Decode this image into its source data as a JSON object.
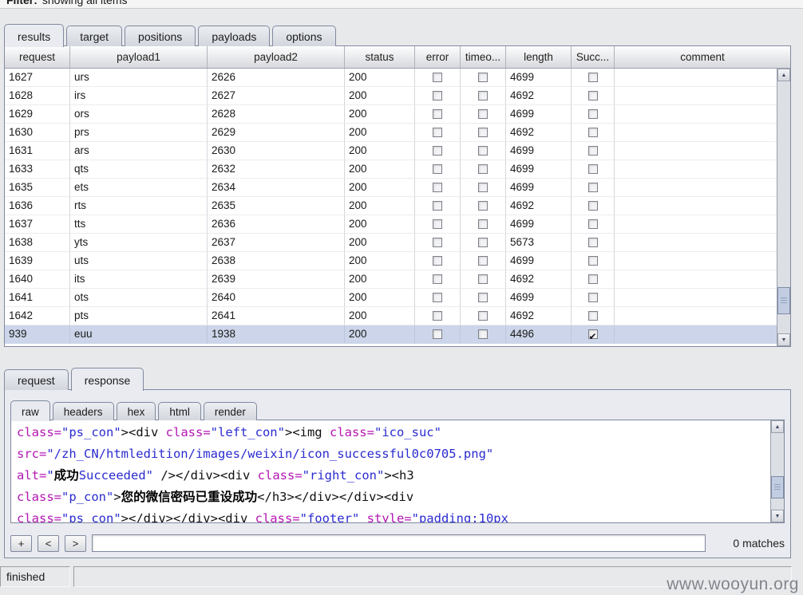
{
  "filter": {
    "label": "Filter:",
    "text": "showing all items"
  },
  "main_tabs": [
    "results",
    "target",
    "positions",
    "payloads",
    "options"
  ],
  "table": {
    "columns": [
      {
        "key": "request",
        "label": "request",
        "type": "text"
      },
      {
        "key": "payload1",
        "label": "payload1",
        "type": "text"
      },
      {
        "key": "payload2",
        "label": "payload2",
        "type": "text"
      },
      {
        "key": "status",
        "label": "status",
        "type": "text"
      },
      {
        "key": "error",
        "label": "error",
        "type": "check"
      },
      {
        "key": "timeout",
        "label": "timeo...",
        "type": "check"
      },
      {
        "key": "length",
        "label": "length",
        "type": "text"
      },
      {
        "key": "success",
        "label": "Succ...",
        "type": "check"
      },
      {
        "key": "comment",
        "label": "comment",
        "type": "text"
      }
    ],
    "selected_index": 14,
    "rows": [
      {
        "request": "1627",
        "payload1": "urs",
        "payload2": "2626",
        "status": "200",
        "error": false,
        "timeout": false,
        "length": "4699",
        "success": false,
        "comment": ""
      },
      {
        "request": "1628",
        "payload1": "irs",
        "payload2": "2627",
        "status": "200",
        "error": false,
        "timeout": false,
        "length": "4692",
        "success": false,
        "comment": ""
      },
      {
        "request": "1629",
        "payload1": "ors",
        "payload2": "2628",
        "status": "200",
        "error": false,
        "timeout": false,
        "length": "4699",
        "success": false,
        "comment": ""
      },
      {
        "request": "1630",
        "payload1": "prs",
        "payload2": "2629",
        "status": "200",
        "error": false,
        "timeout": false,
        "length": "4692",
        "success": false,
        "comment": ""
      },
      {
        "request": "1631",
        "payload1": "ars",
        "payload2": "2630",
        "status": "200",
        "error": false,
        "timeout": false,
        "length": "4699",
        "success": false,
        "comment": ""
      },
      {
        "request": "1633",
        "payload1": "qts",
        "payload2": "2632",
        "status": "200",
        "error": false,
        "timeout": false,
        "length": "4699",
        "success": false,
        "comment": ""
      },
      {
        "request": "1635",
        "payload1": "ets",
        "payload2": "2634",
        "status": "200",
        "error": false,
        "timeout": false,
        "length": "4699",
        "success": false,
        "comment": ""
      },
      {
        "request": "1636",
        "payload1": "rts",
        "payload2": "2635",
        "status": "200",
        "error": false,
        "timeout": false,
        "length": "4692",
        "success": false,
        "comment": ""
      },
      {
        "request": "1637",
        "payload1": "tts",
        "payload2": "2636",
        "status": "200",
        "error": false,
        "timeout": false,
        "length": "4699",
        "success": false,
        "comment": ""
      },
      {
        "request": "1638",
        "payload1": "yts",
        "payload2": "2637",
        "status": "200",
        "error": false,
        "timeout": false,
        "length": "5673",
        "success": false,
        "comment": ""
      },
      {
        "request": "1639",
        "payload1": "uts",
        "payload2": "2638",
        "status": "200",
        "error": false,
        "timeout": false,
        "length": "4699",
        "success": false,
        "comment": ""
      },
      {
        "request": "1640",
        "payload1": "its",
        "payload2": "2639",
        "status": "200",
        "error": false,
        "timeout": false,
        "length": "4692",
        "success": false,
        "comment": ""
      },
      {
        "request": "1641",
        "payload1": "ots",
        "payload2": "2640",
        "status": "200",
        "error": false,
        "timeout": false,
        "length": "4699",
        "success": false,
        "comment": ""
      },
      {
        "request": "1642",
        "payload1": "pts",
        "payload2": "2641",
        "status": "200",
        "error": false,
        "timeout": false,
        "length": "4692",
        "success": false,
        "comment": ""
      },
      {
        "request": "939",
        "payload1": "euu",
        "payload2": "1938",
        "status": "200",
        "error": false,
        "timeout": false,
        "length": "4496",
        "success": true,
        "comment": ""
      }
    ]
  },
  "bottom_tabs": [
    "request",
    "response"
  ],
  "view_tabs": [
    "raw",
    "headers",
    "hex",
    "html",
    "render"
  ],
  "response": {
    "lines": [
      [
        {
          "t": "a",
          "v": "class="
        },
        {
          "t": "s",
          "v": "\"ps_con\""
        },
        {
          "t": "x",
          "v": "><div "
        },
        {
          "t": "a",
          "v": "class="
        },
        {
          "t": "s",
          "v": "\"left_con\""
        },
        {
          "t": "x",
          "v": "><img "
        },
        {
          "t": "a",
          "v": "class="
        },
        {
          "t": "s",
          "v": "\"ico_suc\""
        }
      ],
      [
        {
          "t": "a",
          "v": "src="
        },
        {
          "t": "s",
          "v": "\"/zh_CN/htmledition/images/weixin/icon_successful0c0705.png\""
        }
      ],
      [
        {
          "t": "a",
          "v": "alt="
        },
        {
          "t": "s",
          "v": "\""
        },
        {
          "t": "c",
          "v": "成功"
        },
        {
          "t": "s",
          "v": "Succeeded\""
        },
        {
          "t": "x",
          "v": " /></div><div "
        },
        {
          "t": "a",
          "v": "class="
        },
        {
          "t": "s",
          "v": "\"right_con\""
        },
        {
          "t": "x",
          "v": "><h3"
        }
      ],
      [
        {
          "t": "a",
          "v": "class="
        },
        {
          "t": "s",
          "v": "\"p_con\""
        },
        {
          "t": "x",
          "v": ">"
        },
        {
          "t": "c",
          "v": "您的微信密码已重设成功"
        },
        {
          "t": "x",
          "v": "</h3></div></div><div"
        }
      ],
      [
        {
          "t": "a",
          "v": "class="
        },
        {
          "t": "s",
          "v": "\"ps_con\""
        },
        {
          "t": "x",
          "v": "></div></div><div "
        },
        {
          "t": "a",
          "v": "class="
        },
        {
          "t": "s",
          "v": "\"footer\""
        },
        {
          "t": "x",
          "v": " "
        },
        {
          "t": "a",
          "v": "style="
        },
        {
          "t": "s",
          "v": "\"padding:10px"
        }
      ]
    ]
  },
  "search": {
    "add_label": "+",
    "prev_label": "<",
    "next_label": ">",
    "input_value": "",
    "matches": "0 matches"
  },
  "status": {
    "text": "finished"
  },
  "watermark": "www.wooyun.org"
}
